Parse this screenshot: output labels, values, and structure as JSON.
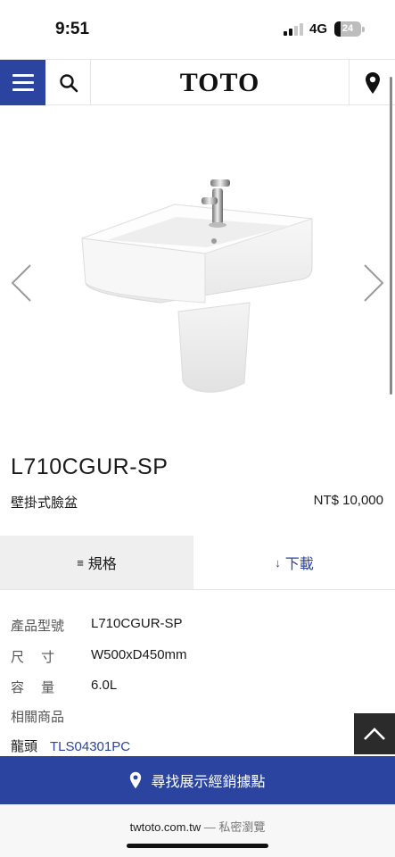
{
  "status_bar": {
    "time": "9:51",
    "network": "4G",
    "battery": "24",
    "battery_level": 0.24
  },
  "header": {
    "logo": "TOTO",
    "icons": [
      "menu-icon",
      "search-icon",
      "location-pin-icon"
    ]
  },
  "gallery": {
    "icons": [
      "chevron-left-icon",
      "chevron-right-icon"
    ]
  },
  "product": {
    "model": "L710CGUR-SP",
    "type": "壁掛式臉盆",
    "price": "NT$ 10,000"
  },
  "tabs": {
    "spec_icon": "≡",
    "spec_label": "規格",
    "download_icon": "↓",
    "download_label": "下載"
  },
  "specs": {
    "model_key": "產品型號",
    "model_val": "L710CGUR-SP",
    "size_key": "尺　 寸",
    "size_val": "W500xD450mm",
    "capacity_key": "容　 量",
    "capacity_val": "6.0L",
    "related_label": "相關商品",
    "faucet_key": "龍頭",
    "faucet_val": "TLS04301PC"
  },
  "locator": {
    "label": "尋找展示經銷據點"
  },
  "browser": {
    "url": "twtoto.com.tw",
    "private": " — 私密瀏覽"
  },
  "colors": {
    "brand_blue": "#2a44a0",
    "tab_active_bg": "#efefef",
    "back_to_top_bg": "#2b2b2b"
  }
}
